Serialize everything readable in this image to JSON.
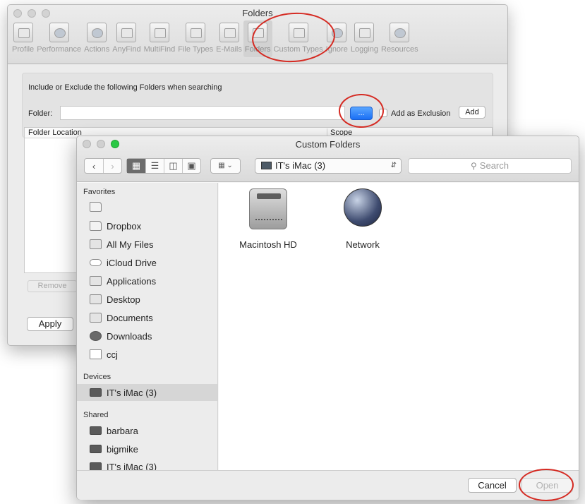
{
  "prefs_window": {
    "title": "Folders",
    "toolbar": [
      {
        "label": "Profile",
        "icon": "profile-icon"
      },
      {
        "label": "Performance",
        "icon": "stopwatch-icon"
      },
      {
        "label": "Actions",
        "icon": "gear-icon"
      },
      {
        "label": "AnyFind",
        "icon": "anyfind-icon"
      },
      {
        "label": "MultiFind",
        "icon": "multifind-icon"
      },
      {
        "label": "File Types",
        "icon": "file-types-icon"
      },
      {
        "label": "E-Mails",
        "icon": "envelope-icon"
      },
      {
        "label": "Folders",
        "icon": "folders-icon"
      },
      {
        "label": "Custom Types",
        "icon": "custom-types-icon"
      },
      {
        "label": "Ignore",
        "icon": "ignore-icon"
      },
      {
        "label": "Logging",
        "icon": "logging-icon"
      },
      {
        "label": "Resources",
        "icon": "resources-icon"
      }
    ],
    "selected_tab": "Folders",
    "panel": {
      "heading": "Include or Exclude the following Folders when searching",
      "folder_label": "Folder:",
      "folder_value": "",
      "browse_label": "...",
      "exclusion_label": "Add as Exclusion",
      "exclusion_checked": false,
      "add_label": "Add"
    },
    "table": {
      "columns": [
        "Folder Location",
        "Scope"
      ]
    },
    "remove_label": "Remove",
    "apply_label": "Apply"
  },
  "dialog": {
    "title": "Custom Folders",
    "location": "IT's iMac (3)",
    "search_placeholder": "Search",
    "sidebar": {
      "favorites_heading": "Favorites",
      "favorites": [
        {
          "label": "",
          "icon": "folder-icon"
        },
        {
          "label": "Dropbox",
          "icon": "folder-icon"
        },
        {
          "label": "All My Files",
          "icon": "all-files-icon"
        },
        {
          "label": "iCloud Drive",
          "icon": "cloud-icon"
        },
        {
          "label": "Applications",
          "icon": "applications-icon"
        },
        {
          "label": "Desktop",
          "icon": "desktop-icon"
        },
        {
          "label": "Documents",
          "icon": "documents-icon"
        },
        {
          "label": "Downloads",
          "icon": "downloads-icon"
        },
        {
          "label": "ccj",
          "icon": "home-icon"
        }
      ],
      "devices_heading": "Devices",
      "devices": [
        {
          "label": "IT's iMac (3)",
          "icon": "imac-icon",
          "selected": true
        }
      ],
      "shared_heading": "Shared",
      "shared": [
        {
          "label": "barbara",
          "icon": "computer-icon"
        },
        {
          "label": "bigmike",
          "icon": "computer-icon"
        },
        {
          "label": "IT's iMac (3)",
          "icon": "computer-icon"
        }
      ]
    },
    "volumes": [
      {
        "label": "Macintosh HD",
        "icon": "hard-drive-icon"
      },
      {
        "label": "Network",
        "icon": "network-globe-icon"
      }
    ],
    "cancel_label": "Cancel",
    "open_label": "Open",
    "open_enabled": false
  },
  "annotation_color": "#d52a22"
}
